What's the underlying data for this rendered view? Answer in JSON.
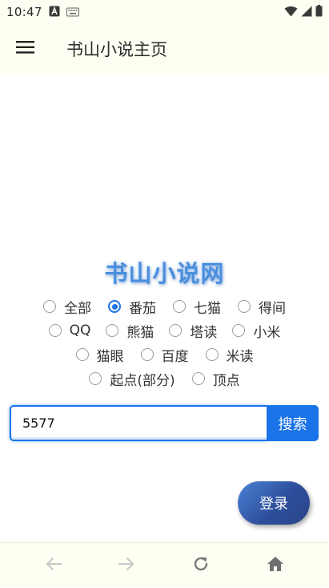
{
  "status_bar": {
    "time": "10:47",
    "icons": [
      "a-notification-icon",
      "keyboard-icon",
      "wifi-icon",
      "signal-icon",
      "battery-icon"
    ]
  },
  "app_bar": {
    "menu_icon": "hamburger-menu-icon",
    "title": "书山小说主页"
  },
  "site_title": "书山小说网",
  "sources": {
    "row1": [
      {
        "label": "全部",
        "selected": false
      },
      {
        "label": "番茄",
        "selected": true
      },
      {
        "label": "七猫",
        "selected": false
      },
      {
        "label": "得间",
        "selected": false
      }
    ],
    "row2": [
      {
        "label": "QQ",
        "selected": false
      },
      {
        "label": "熊猫",
        "selected": false
      },
      {
        "label": "塔读",
        "selected": false
      },
      {
        "label": "小米",
        "selected": false
      }
    ],
    "row3": [
      {
        "label": "猫眼",
        "selected": false
      },
      {
        "label": "百度",
        "selected": false
      },
      {
        "label": "米读",
        "selected": false
      }
    ],
    "row4": [
      {
        "label": "起点(部分)",
        "selected": false
      },
      {
        "label": "顶点",
        "selected": false
      }
    ]
  },
  "search": {
    "value": "5577",
    "button_label": "搜索"
  },
  "login_label": "登录",
  "bottom_nav": {
    "icons": [
      "back-arrow-icon",
      "forward-arrow-icon",
      "reload-icon",
      "home-icon"
    ]
  },
  "colors": {
    "accent": "#1a73e8",
    "title_blue": "#4a8fde",
    "bar_background": "#fffef2",
    "login_gradient": "#2d4f9c"
  }
}
